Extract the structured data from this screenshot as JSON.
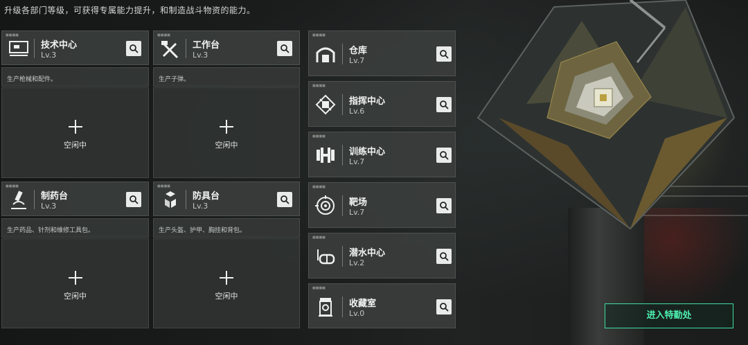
{
  "intro": "升级各部门等级，可获得专属能力提升，和制造战斗物资的能力。",
  "workshops": [
    {
      "name": "技术中心",
      "level": "Lv.3",
      "desc": "生产枪械和配件。",
      "slot": "空闲中",
      "icon": "monitor-icon"
    },
    {
      "name": "工作台",
      "level": "Lv.3",
      "desc": "生产子弹。",
      "slot": "空闲中",
      "icon": "tools-icon"
    },
    {
      "name": "制药台",
      "level": "Lv.3",
      "desc": "生产药品、针剂和维修工具包。",
      "slot": "空闲中",
      "icon": "microscope-icon"
    },
    {
      "name": "防具台",
      "level": "Lv.3",
      "desc": "生产头盔、护甲、胸挂和背包。",
      "slot": "空闲中",
      "icon": "boxes-icon"
    }
  ],
  "facilities": [
    {
      "name": "仓库",
      "level": "Lv.7",
      "icon": "warehouse-icon"
    },
    {
      "name": "指挥中心",
      "level": "Lv.6",
      "icon": "chip-icon"
    },
    {
      "name": "训练中心",
      "level": "Lv.7",
      "icon": "dumbbell-icon"
    },
    {
      "name": "靶场",
      "level": "Lv.7",
      "icon": "target-icon"
    },
    {
      "name": "潜水中心",
      "level": "Lv.2",
      "icon": "diving-mask-icon"
    },
    {
      "name": "收藏室",
      "level": "Lv.0",
      "icon": "collection-icon"
    }
  ],
  "enter_button": "进入特勤处",
  "colors": {
    "accent": "#3fe0a3",
    "panel": "#3a3d3c"
  }
}
